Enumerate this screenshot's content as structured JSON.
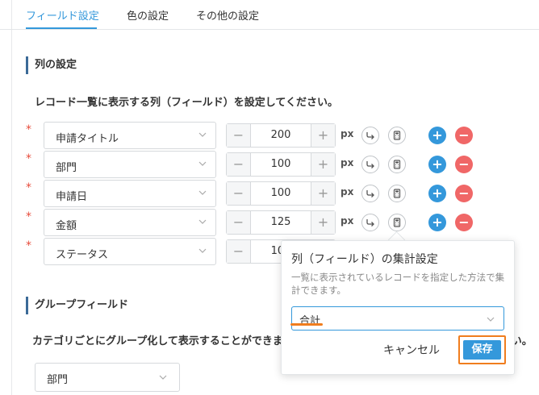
{
  "tabs": [
    {
      "label": "フィールド設定",
      "active": true
    },
    {
      "label": "色の設定",
      "active": false
    },
    {
      "label": "その他の設定",
      "active": false
    }
  ],
  "columns_section": {
    "title": "列の設定",
    "description": "レコード一覧に表示する列（フィールド）を設定してください。",
    "required_mark": "*",
    "unit": "px",
    "rows": [
      {
        "field": "申請タイトル",
        "width": "200"
      },
      {
        "field": "部門",
        "width": "100"
      },
      {
        "field": "申請日",
        "width": "100"
      },
      {
        "field": "金額",
        "width": "125"
      },
      {
        "field": "ステータス",
        "width": "100"
      }
    ],
    "minus_label": "−",
    "plus_label": "+",
    "add_label": "+",
    "remove_label": "−"
  },
  "group_section": {
    "title": "グループフィールド",
    "description": "カテゴリごとにグループ化して表示することができます。グループ化するフィールドを選択してください。",
    "selected": "部門"
  },
  "aggregate_popover": {
    "title": "列（フィールド）の集計設定",
    "description": "一覧に表示されているレコードを指定した方法で集計できます。",
    "selected": "合計",
    "cancel_label": "キャンセル",
    "save_label": "保存"
  },
  "colors": {
    "accent": "#3498db",
    "danger": "#f06767",
    "highlight": "#f07d1e",
    "header_bar": "#3b6a97"
  }
}
